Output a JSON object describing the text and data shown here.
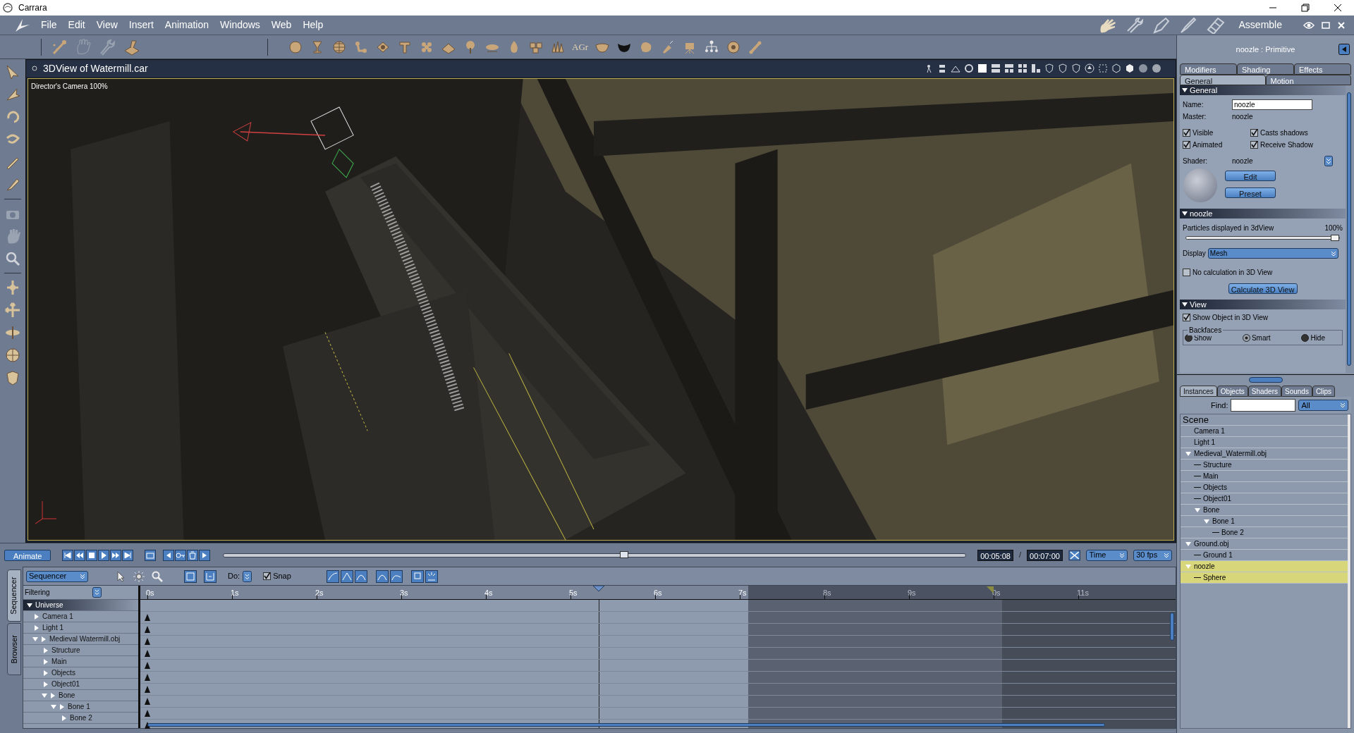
{
  "window": {
    "title": "Carrara"
  },
  "menu": [
    "File",
    "Edit",
    "View",
    "Insert",
    "Animation",
    "Windows",
    "Web",
    "Help"
  ],
  "toolbar": {
    "text_tool": "AGr"
  },
  "rooms": {
    "current": "Assemble"
  },
  "viewport": {
    "title": "3DView of Watermill.car",
    "camera_label": "Director's Camera 100%"
  },
  "properties": {
    "header": "noozle : Primitive",
    "tabs": [
      {
        "label": "Modifiers",
        "selected": false
      },
      {
        "label": "Shading",
        "selected": false
      },
      {
        "label": "Effects",
        "selected": false
      }
    ],
    "subtabs": [
      {
        "label": "General",
        "selected": true
      },
      {
        "label": "Motion",
        "selected": false
      }
    ],
    "general": {
      "heading": "General",
      "name_label": "Name:",
      "name_value": "noozle",
      "master_label": "Master:",
      "master_value": "noozle",
      "checks": [
        {
          "label": "Visible",
          "checked": true
        },
        {
          "label": "Casts shadows",
          "checked": true
        },
        {
          "label": "Animated",
          "checked": true
        },
        {
          "label": "Receive Shadow",
          "checked": true
        }
      ],
      "shader_label": "Shader:",
      "shader_value": "noozle",
      "buttons": [
        "Edit",
        "Preset"
      ]
    },
    "particles": {
      "heading": "noozle",
      "slider_label": "Particles displayed in 3dView",
      "slider_reading": "100%",
      "level": 1.0,
      "display_label": "Display",
      "display_value": "Mesh",
      "no_calc": {
        "label": "No calculation in 3D View",
        "checked": false
      },
      "button": "Calculate 3D View"
    },
    "view": {
      "heading": "View",
      "show_object": {
        "label": "Show Object in 3D View",
        "checked": true
      },
      "group": "Backfaces",
      "radios": [
        {
          "label": "Show",
          "selected": false
        },
        {
          "label": "Smart",
          "selected": true
        },
        {
          "label": "Hide",
          "selected": false
        }
      ]
    }
  },
  "browser": {
    "tabs": [
      {
        "label": "Instances",
        "selected": true
      },
      {
        "label": "Objects",
        "selected": false
      },
      {
        "label": "Shaders",
        "selected": false
      },
      {
        "label": "Sounds",
        "selected": false
      },
      {
        "label": "Clips",
        "selected": false
      }
    ],
    "find_label": "Find:",
    "filter_value": "All",
    "root": "Scene",
    "tree": [
      {
        "label": "Camera 1",
        "selected": false
      },
      {
        "label": "Light 1",
        "selected": false
      },
      {
        "label": "Medieval_Watermill.obj",
        "selected": false,
        "expanded": true,
        "children": [
          {
            "label": "Structure",
            "selected": false
          },
          {
            "label": "Main",
            "selected": false
          },
          {
            "label": "Objects",
            "selected": false
          },
          {
            "label": "Object01",
            "selected": false
          },
          {
            "label": "Bone",
            "selected": false,
            "expanded": true,
            "children": [
              {
                "label": "Bone 1",
                "selected": false,
                "expanded": true,
                "children": [
                  {
                    "label": "Bone 2",
                    "selected": false
                  }
                ]
              }
            ]
          }
        ]
      },
      {
        "label": "Ground.obj",
        "selected": false,
        "expanded": true,
        "children": [
          {
            "label": "Ground 1",
            "selected": false
          }
        ]
      },
      {
        "label": "noozle",
        "selected": true,
        "expanded": true,
        "children": [
          {
            "label": "Sphere",
            "selected": true
          }
        ]
      }
    ]
  },
  "animation": {
    "animate_button": "Animate",
    "level": 0.54,
    "current_time": "00:05:08",
    "separator": "/",
    "end_time": "00:07:00",
    "units": "Time",
    "fps": "30 fps"
  },
  "sequencer": {
    "side_tabs": [
      {
        "label": "Sequencer",
        "selected": true
      },
      {
        "label": "Browser",
        "selected": false
      }
    ],
    "mode": "Sequencer",
    "do_label": "Do:",
    "snap": {
      "label": "Snap",
      "checked": true
    },
    "filtering": "Filtering",
    "ruler": [
      "0s",
      "1s",
      "2s",
      "3s",
      "4s",
      "5s",
      "6s",
      "7s",
      "8s",
      "9s",
      "0s",
      "11s"
    ],
    "tree": [
      {
        "label": "Universe",
        "expanded": true,
        "children": [
          {
            "label": "Camera 1"
          },
          {
            "label": "Light 1"
          },
          {
            "label": "Medieval Watermill.obj",
            "expanded": true,
            "children": [
              {
                "label": "Structure"
              },
              {
                "label": "Main"
              },
              {
                "label": "Objects"
              },
              {
                "label": "Object01"
              },
              {
                "label": "Bone",
                "expanded": true,
                "children": [
                  {
                    "label": "Bone 1",
                    "expanded": true,
                    "children": [
                      {
                        "label": "Bone 2"
                      }
                    ]
                  }
                ]
              }
            ]
          }
        ]
      }
    ]
  }
}
